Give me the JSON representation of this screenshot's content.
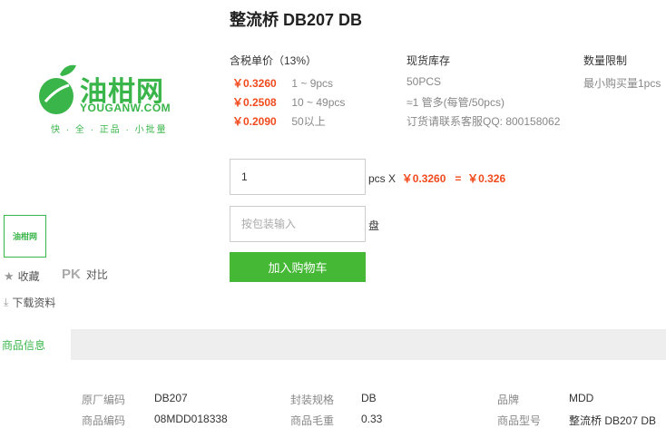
{
  "product": {
    "title": "整流桥 DB207 DB"
  },
  "logo": {
    "name": "油柑网",
    "domain": "YOUGANW.COM",
    "slogan": "快 · 全 · 正品 · 小批量",
    "thumb_text": "油柑网"
  },
  "actions": {
    "favorite": "收藏",
    "pk_mark": "PK",
    "compare": "对比",
    "download": "下载资料"
  },
  "pricing": {
    "header": "含税单价（13%）",
    "tiers": [
      {
        "price": "￥0.3260",
        "range": "1 ~ 9pcs"
      },
      {
        "price": "￥0.2508",
        "range": "10 ~ 49pcs"
      },
      {
        "price": "￥0.2090",
        "range": "50以上"
      }
    ]
  },
  "stock": {
    "header": "现货库存",
    "lines": [
      "50PCS",
      "≈1 管多(每管/50pcs)",
      "订货请联系客服QQ: 800158062"
    ]
  },
  "limit": {
    "header": "数量限制",
    "text": "最小购买量1pcs"
  },
  "order": {
    "quantity_value": "1",
    "unit_times": "pcs X",
    "unit_price": "￥0.3260",
    "equals": "=",
    "total": "￥0.326",
    "pack_placeholder": "按包装输入",
    "pack_unit": "盘",
    "add_to_cart": "加入购物车"
  },
  "tabs": {
    "active": "商品信息"
  },
  "specs": [
    {
      "label": "原厂编码",
      "value": "DB207"
    },
    {
      "label": "封装规格",
      "value": "DB"
    },
    {
      "label": "品牌",
      "value": "MDD"
    },
    {
      "label": "商品编码",
      "value": "08MDD018338"
    },
    {
      "label": "商品毛重",
      "value": "0.33"
    },
    {
      "label": "商品型号",
      "value": "整流桥 DB207 DB"
    }
  ],
  "colors": {
    "brand_green": "#39b54a",
    "price_red": "#f24a1d",
    "button_green": "#45b835"
  }
}
